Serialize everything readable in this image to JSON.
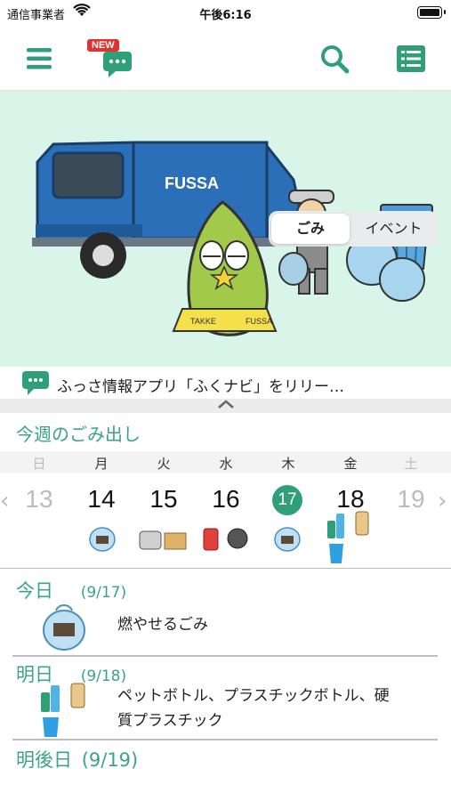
{
  "status_bar": {
    "carrier": "通信事業者",
    "time": "午後6:16"
  },
  "toolbar": {
    "new_badge": "NEW",
    "icons": [
      "menu-icon",
      "chat-icon",
      "search-icon",
      "list-icon"
    ]
  },
  "hero": {
    "segment": {
      "options": [
        "ごみ",
        "イベント"
      ],
      "selected": "ごみ"
    },
    "truck_text": "FUSSA",
    "mascot_sash_left": "TAKKE",
    "mascot_sash_right": "FUSSA"
  },
  "news": {
    "text": "ふっさ情報アプリ「ふくナビ」をリリー…"
  },
  "week": {
    "title": "今週のごみ出し",
    "days": [
      {
        "dow": "日",
        "date": "13",
        "muted": true
      },
      {
        "dow": "月",
        "date": "14",
        "muted": false
      },
      {
        "dow": "火",
        "date": "15",
        "muted": false
      },
      {
        "dow": "水",
        "date": "16",
        "muted": false
      },
      {
        "dow": "木",
        "date": "17",
        "muted": false,
        "today": true
      },
      {
        "dow": "金",
        "date": "18",
        "muted": false
      },
      {
        "dow": "土",
        "date": "19",
        "muted": true
      }
    ]
  },
  "schedule": [
    {
      "label": "今日",
      "date": "(9/17)",
      "item": "燃やせるごみ"
    },
    {
      "label": "明日",
      "date": "(9/18)",
      "item_line1": "ペットボトル、プラスチックボトル、硬",
      "item_line2": "質プラスチック"
    },
    {
      "label": "明後日",
      "date": "(9/19)"
    }
  ],
  "colors": {
    "accent": "#3aa57f",
    "hero_bg": "#d9f4e9",
    "today": "#2f9f78"
  }
}
